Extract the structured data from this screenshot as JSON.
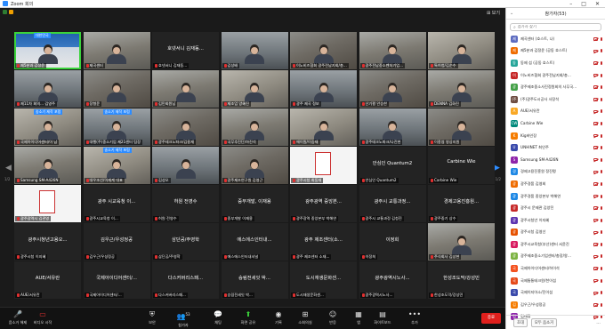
{
  "window": {
    "title": "Zoom 회의"
  },
  "main": {
    "view_label": "보기",
    "page_left": "1/2",
    "page_right": "1/2"
  },
  "tiles": [
    {
      "name": "제5분과 김정윤",
      "label": "",
      "kind": "blue",
      "banner": "대한민국"
    },
    {
      "name": "제곡센터",
      "label": "",
      "kind": "video"
    },
    {
      "name": "호넷서니 김재동...",
      "label": "호넷서니 김재동...",
      "kind": "dark"
    },
    {
      "name": "김성배",
      "label": "",
      "kind": "video"
    },
    {
      "name": "이노비즈협회 광주전남지회/총...",
      "label": "",
      "kind": "video"
    },
    {
      "name": "광주전남중소벤처기업...",
      "label": "",
      "kind": "video"
    },
    {
      "name": "특허청/김순수",
      "label": "",
      "kind": "video"
    },
    {
      "name": "제11차 회의... 김영주",
      "label": "",
      "kind": "video"
    },
    {
      "name": "장형윤",
      "label": "",
      "kind": "video"
    },
    {
      "name": "김민회원님",
      "label": "",
      "kind": "video"
    },
    {
      "name": "제조업 양혜진",
      "label": "",
      "kind": "video"
    },
    {
      "name": "광주 제곡 정보",
      "label": "",
      "kind": "video"
    },
    {
      "name": "산기평 안승한",
      "label": "",
      "kind": "video"
    },
    {
      "name": "DENNA 김화진",
      "label": "",
      "kind": "video"
    },
    {
      "name": "국제아이디어센터/이 남",
      "label": "",
      "kind": "video",
      "banner": "송소기 제작 포럼"
    },
    {
      "name": "대행(주)중소기업 제21센터 팀장",
      "label": "",
      "kind": "video",
      "banner": "송소기 제작 포럼"
    },
    {
      "name": "광주테크노파크/김용재",
      "label": "",
      "kind": "video"
    },
    {
      "name": "국무추진단/하진석",
      "label": "",
      "kind": "video"
    },
    {
      "name": "에이원/이승재",
      "label": "",
      "kind": "video"
    },
    {
      "name": "광주테크노파크/나진현",
      "label": "",
      "kind": "video"
    },
    {
      "name": "이종엽 영상지원",
      "label": "",
      "kind": "video"
    },
    {
      "name": "Samsung SM-A426N",
      "label": "",
      "kind": "video"
    },
    {
      "name": "대우조선/이재계 대표",
      "label": "",
      "kind": "video",
      "banner": "송소기 제작 포럼"
    },
    {
      "name": "김성오",
      "label": "",
      "kind": "video"
    },
    {
      "name": "광주제조연구원 김영근",
      "label": "",
      "kind": "video"
    },
    {
      "name": "광주시청 최동재",
      "label": "",
      "kind": "poster"
    },
    {
      "name": "안심인 Quantum2",
      "label": "안심인 Quantum2",
      "kind": "dark"
    },
    {
      "name": "Carbine Wie",
      "label": "Carbine Wie",
      "kind": "dark"
    },
    {
      "name": "광주광역시 김관영",
      "label": "",
      "kind": "poster"
    },
    {
      "name": "광주시교육청 이...",
      "label": "광주 시교육청 이...",
      "kind": "dark"
    },
    {
      "name": "허원 전영수",
      "label": "허원 전영수",
      "kind": "dark"
    },
    {
      "name": "중부개발 이재용",
      "label": "중부개발, 이재용",
      "kind": "dark"
    },
    {
      "name": "광주광역 중앙본부 박해연",
      "label": "광주광역 중앙본...",
      "kind": "dark"
    },
    {
      "name": "광주시 교통과정 김청진",
      "label": "광주시 교통과정...",
      "kind": "dark"
    },
    {
      "name": "광주중기 상수",
      "label": "경제고용진흥원...",
      "kind": "dark"
    },
    {
      "name": "광주시청 이지혜",
      "label": "광주시청년고용오...",
      "kind": "dark"
    },
    {
      "name": "김우근/우성정공",
      "label": "김우근/우성정공",
      "kind": "dark"
    },
    {
      "name": "삼단공/주영학",
      "label": "삼단공/주영학",
      "kind": "dark"
    },
    {
      "name": "에스에스인터내셔널",
      "label": "에스에스인터내...",
      "kind": "dark"
    },
    {
      "name": "광주 제조센터 소재...",
      "label": "광주 제조센터(소...",
      "kind": "dark"
    },
    {
      "name": "이정희",
      "label": "이정희",
      "kind": "dark"
    },
    {
      "name": "주식회사 김상현",
      "label": "",
      "kind": "video"
    },
    {
      "name": "AUE/서유란",
      "label": "AUE/서유란",
      "kind": "dark"
    },
    {
      "name": "국제아이디어센터/...",
      "label": "국제아이디어센터/...",
      "kind": "dark"
    },
    {
      "name": "다스커버리스패...",
      "label": "다스커버리스패...",
      "kind": "dark"
    },
    {
      "name": "승림전세잇 박...",
      "label": "승림전세잇 박...",
      "kind": "dark"
    },
    {
      "name": "도시재생문화센...",
      "label": "도시재생문화센...",
      "kind": "dark"
    },
    {
      "name": "광주광역시노사...",
      "label": "광주광역시노사...",
      "kind": "dark"
    },
    {
      "name": "한성조도막/강성민",
      "label": "한성조도막/강성민",
      "kind": "dark"
    }
  ],
  "toolbar": {
    "mute": "음소거 해제",
    "video": "비디오 시작",
    "security": "보안",
    "participants": "참가자",
    "participants_count": "53",
    "chat": "채팅",
    "share": "화면 공유",
    "record": "기록",
    "reactions": "소회의실",
    "reactions2": "반응",
    "apps": "앱",
    "whiteboard": "화이트보드",
    "more": "추가",
    "end": "종료"
  },
  "panel": {
    "title": "참가자(53)",
    "search_placeholder": "참가자 찾기",
    "participants": [
      {
        "initial": "제",
        "name": "제곡센터 (호스트, 나)",
        "color": "#5c6bc0"
      },
      {
        "initial": "제",
        "name": "제5분과 김정윤 (공동 호스트)",
        "color": "#ef6c00"
      },
      {
        "initial": "동",
        "name": "동제 섭 (공동 호스트)",
        "color": "#26a69a"
      },
      {
        "initial": "이",
        "name": "이노비즈협회 광주전남지회/총...",
        "color": "#c62828"
      },
      {
        "initial": "광",
        "name": "광주제조중소사진정원회의 사무국...",
        "color": "#43a047"
      },
      {
        "initial": "(주",
        "name": "(주)광주도시공사 사장석",
        "color": "#6d4c41"
      },
      {
        "initial": "A",
        "name": "AUE/서유란",
        "color": "#f9a825"
      },
      {
        "initial": "CW",
        "name": "Carbine Wie",
        "color": "#00897b"
      },
      {
        "initial": "K",
        "name": "Kig바인장",
        "color": "#f57c00"
      },
      {
        "initial": "U",
        "name": "UNHINET 최인주",
        "color": "#3949ab"
      },
      {
        "initial": "S",
        "name": "Samsung SM-A426N",
        "color": "#8e24aa"
      },
      {
        "initial": "경",
        "name": "경제고용진흥원 정진평",
        "color": "#1e88e5"
      },
      {
        "initial": "광",
        "name": "광주경품 김영회",
        "color": "#ef6c00"
      },
      {
        "initial": "광",
        "name": "광주경품 중앙본부 박해연",
        "color": "#1e88e5"
      },
      {
        "initial": "광",
        "name": "광주시 문제관 김양진",
        "color": "#c62828"
      },
      {
        "initial": "광",
        "name": "광주시청년 이지혜",
        "color": "#5e35b1"
      },
      {
        "initial": "광",
        "name": "광주시청 김영선",
        "color": "#e65100"
      },
      {
        "initial": "광",
        "name": "광주시교육청(부산)센터 서윤진",
        "color": "#d81b60"
      },
      {
        "initial": "광",
        "name": "광주제조중소기업센터/총장/왕...",
        "color": "#7cb342"
      },
      {
        "initial": "국",
        "name": "국제아이디어센터/허이석",
        "color": "#f4511e"
      },
      {
        "initial": "국",
        "name": "국제통통테크원/천이섭",
        "color": "#e64a19"
      },
      {
        "initial": "국",
        "name": "국제이지아소/진이섭",
        "color": "#3949ab"
      },
      {
        "initial": "김",
        "name": "김우근/우성정공",
        "color": "#f57c00"
      },
      {
        "initial": "김",
        "name": "김태광",
        "color": "#8e24aa"
      }
    ],
    "invite": "초대",
    "mute_all": "모두 음소거",
    "more": "..."
  }
}
